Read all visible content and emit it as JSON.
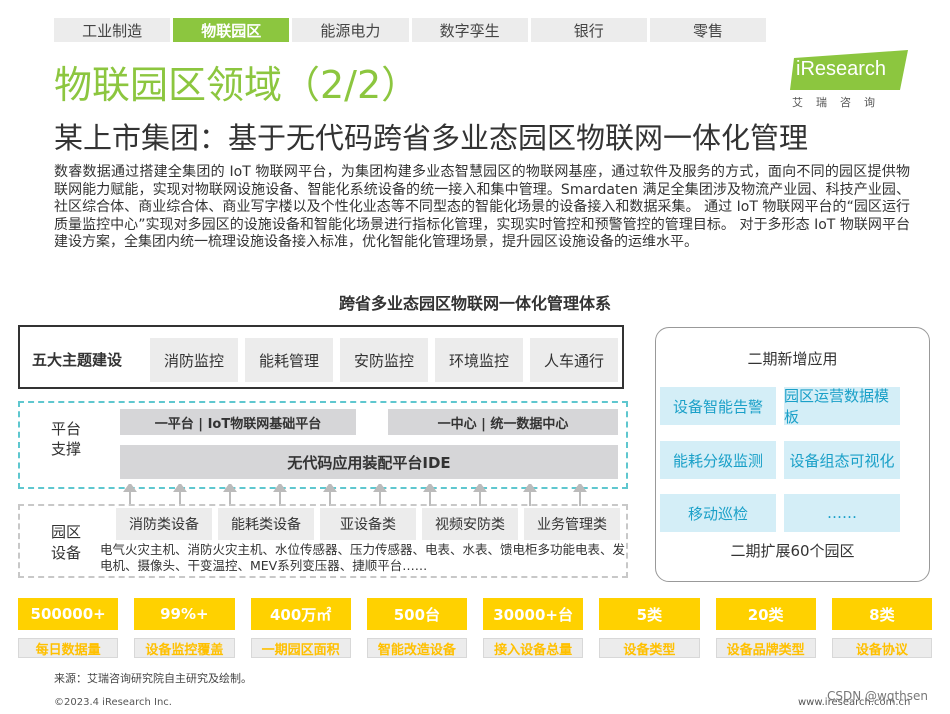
{
  "tabs": [
    "工业制造",
    "物联园区",
    "能源电力",
    "数字孪生",
    "银行",
    "零售"
  ],
  "active_tab_index": 1,
  "logo": {
    "text": "iResearch",
    "subtitle": "艾瑞咨询",
    "color": "#8cc63f"
  },
  "title": "物联园区领域（2/2）",
  "subtitle": "某上市集团：基于无代码跨省多业态园区物联网一体化管理",
  "intro": "数睿数据通过搭建全集团的 IoT 物联网平台，为集团构建多业态智慧园区的物联网基座，通过软件及服务的方式，面向不同的园区提供物联网能力赋能，实现对物联网设施设备、智能化系统设备的统一接入和集中管理。Smardaten 满足全集团涉及物流产业园、科技产业园、社区综合体、商业综合体、商业写字楼以及个性化业态等不同型态的智能化场景的设备接入和数据采集。 通过 IoT 物联网平台的“园区运行质量监控中心”实现对多园区的设施设备和智能化场景进行指标化管理，实现实时管控和预警管控的管理目标。 对于多形态 IoT 物联网平台建设方案，全集团内统一梳理设施设备接入标准，优化智能化管理场景，提升园区设施设备的运维水平。",
  "diagram": {
    "title": "跨省多业态园区物联网一体化管理体系",
    "themes_label": "五大主题建设",
    "themes": [
      "消防监控",
      "能耗管理",
      "安防监控",
      "环境监控",
      "人车通行"
    ],
    "platform_label": "平台\n支撑",
    "platform_left": "一平台 |  IoT物联网基础平台",
    "platform_right": "一中心 |  统一数据中心",
    "platform_bottom": "无代码应用装配平台IDE",
    "devices_label": "园区\n设备",
    "device_types": [
      "消防类设备",
      "能耗类设备",
      "亚设备类",
      "视频安防类",
      "业务管理类"
    ],
    "devices_desc": "电气火灾主机、消防火灾主机、水位传感器、压力传感器、电表、水表、馈电柜多功能电表、发电机、摄像头、干变温控、MEV系列变压器、捷顺平台……"
  },
  "phase2": {
    "title": "二期新增应用",
    "apps": [
      "设备智能告警",
      "园区运营数据模板",
      "能耗分级监测",
      "设备组态可视化",
      "移动巡检",
      "……"
    ],
    "footer": "二期扩展60个园区"
  },
  "stats": [
    {
      "value": "500000+",
      "label": "每日数据量"
    },
    {
      "value": "99%+",
      "label": "设备监控覆盖"
    },
    {
      "value": "400万㎡",
      "label": "一期园区面积"
    },
    {
      "value": "500台",
      "label": "智能改造设备"
    },
    {
      "value": "30000+台",
      "label": "接入设备总量"
    },
    {
      "value": "5类",
      "label": "设备类型"
    },
    {
      "value": "20类",
      "label": "设备品牌类型"
    },
    {
      "value": "8类",
      "label": "设备协议"
    }
  ],
  "source": "来源：艾瑞咨询研究院自主研究及绘制。",
  "copyright": "©2023.4 iResearch Inc.",
  "site": "www.iresearch.com.cn",
  "watermark": "CSDN @wqthsen",
  "colors": {
    "green": "#8cc63f",
    "yellow": "#ffd100",
    "cyan": "#5fc7cf",
    "light_blue": "#d4eef7"
  }
}
